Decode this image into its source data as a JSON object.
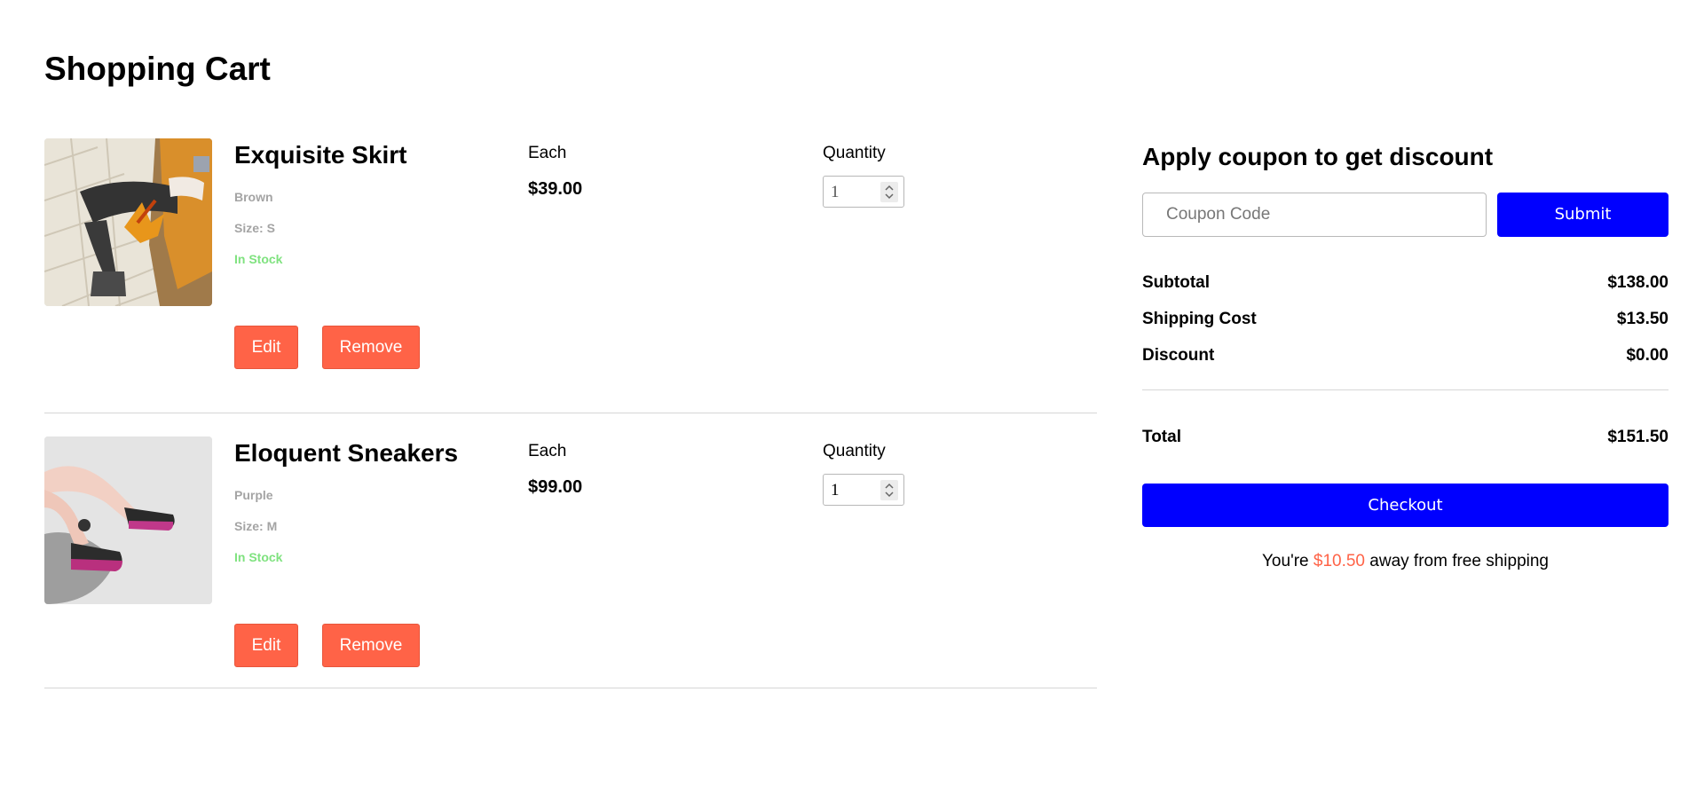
{
  "page": {
    "title": "Shopping Cart"
  },
  "cart": {
    "each_label": "Each",
    "quantity_label": "Quantity",
    "edit_label": "Edit",
    "remove_label": "Remove",
    "items": [
      {
        "name": "Exquisite Skirt",
        "color": "Brown",
        "size": "Size: S",
        "stock": "In Stock",
        "price": "$39.00",
        "quantity": "1",
        "image_icon": "skirt-photo"
      },
      {
        "name": "Eloquent Sneakers",
        "color": "Purple",
        "size": "Size: M",
        "stock": "In Stock",
        "price": "$99.00",
        "quantity": "1",
        "image_icon": "sneakers-photo"
      }
    ]
  },
  "summary": {
    "coupon_title": "Apply coupon to get discount",
    "coupon_placeholder": "Coupon Code",
    "submit_label": "Submit",
    "subtotal_label": "Subtotal",
    "subtotal_value": "$138.00",
    "shipping_label": "Shipping Cost",
    "shipping_value": "$13.50",
    "discount_label": "Discount",
    "discount_value": "$0.00",
    "total_label": "Total",
    "total_value": "$151.50",
    "checkout_label": "Checkout",
    "free_ship_prefix": "You're",
    "free_ship_amount": "$10.50",
    "free_ship_suffix": "away from free shipping"
  },
  "colors": {
    "accent": "#0000ff",
    "danger": "#ff6347",
    "in_stock": "#7fe27f",
    "muted": "#a4a4a4"
  }
}
